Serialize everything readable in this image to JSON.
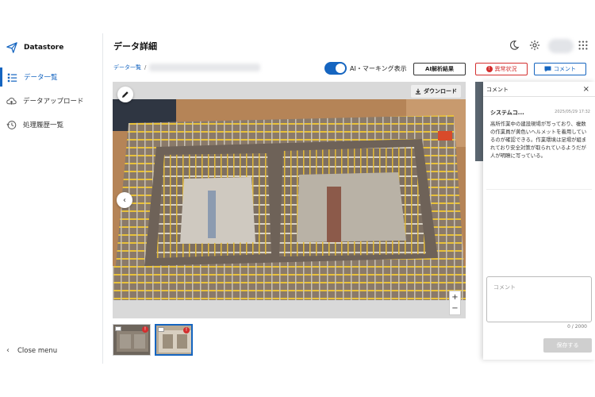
{
  "sidebar": {
    "brand": "Datastore",
    "items": [
      {
        "label": "データ一覧",
        "icon": "list-icon",
        "active": true
      },
      {
        "label": "データアップロード",
        "icon": "cloud-upload-icon",
        "active": false
      },
      {
        "label": "処理履歴一覧",
        "icon": "history-icon",
        "active": false
      }
    ],
    "close_menu": "Close menu"
  },
  "header": {
    "title": "データ詳細",
    "icons": [
      "moon-icon",
      "gear-icon",
      "apps-grid-icon"
    ]
  },
  "toolbar": {
    "breadcrumb_root": "データ一覧",
    "breadcrumb_sep": "/",
    "toggle_label": "AI・マーキング表示",
    "toggle_on": true,
    "ai_button": "AI解析結果",
    "anomaly_button": "異常状況",
    "comment_button": "コメント"
  },
  "viewer": {
    "download": "ダウンロード",
    "prev": "‹",
    "zoom_in": "+",
    "zoom_out": "−"
  },
  "thumbnails": [
    {
      "badge": "!",
      "selected": false
    },
    {
      "badge": "!",
      "selected": true
    }
  ],
  "comment_panel": {
    "title": "コメント",
    "close": "×",
    "comment": {
      "author": "システムコ...",
      "time": "2025/05/29 17:32",
      "body": "高所作業中の建設現場が写っており、複数の作業員が黄色いヘルメットを着用しているのが確認できる。作業環境は足場が組まれており安全対策が取られているようだが人が明瞭に写っている。"
    },
    "placeholder": "コメント",
    "char_count": "0 / 2000",
    "save": "保存する"
  },
  "colors": {
    "primary": "#1565c0",
    "danger": "#d32f2f"
  }
}
